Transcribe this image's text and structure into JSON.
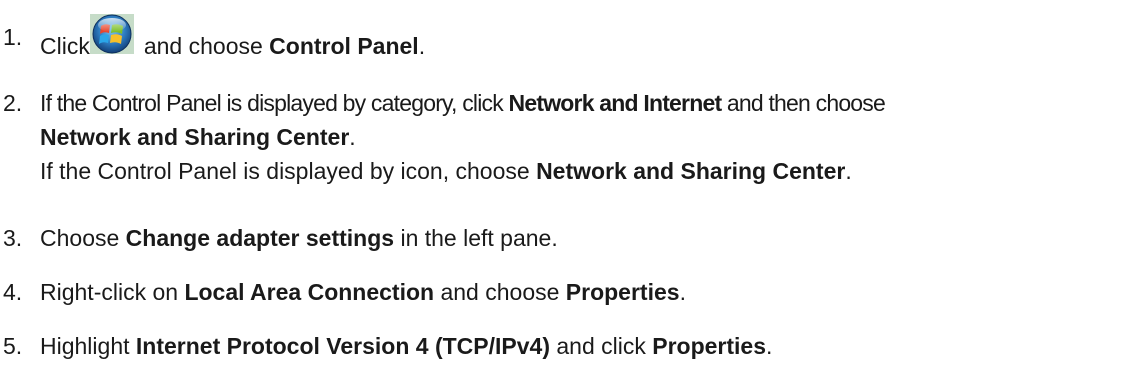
{
  "steps": [
    {
      "number": "1.",
      "click": "Click",
      "icon": "windows-start-orb-icon",
      "after_icon": "and choose",
      "target": "Control Panel",
      "end": "."
    },
    {
      "number": "2.",
      "line1_a": "If the Control Panel is displayed by category, click",
      "line1_b": "Network and Internet",
      "line1_c": "and then choose",
      "line2_a": "Network and Sharing Center",
      "line2_b": ".",
      "line3_a": "If the Control Panel is displayed by icon, choose",
      "line3_b": "Network and Sharing Center",
      "line3_c": "."
    },
    {
      "number": "3.",
      "a": "Choose",
      "b": "Change adapter settings",
      "c": "in the left pane."
    },
    {
      "number": "4.",
      "a": "Right-click on",
      "b": "Local Area Connection",
      "c": "and choose",
      "d": "Properties",
      "e": "."
    },
    {
      "number": "5.",
      "a": "Highlight",
      "b": "Internet Protocol Version 4 (TCP/IPv4)",
      "c": "and click",
      "d": "Properties",
      "e": "."
    }
  ],
  "colors": {
    "text": "#1a1a1a",
    "orb_blue": "#2f6fb8",
    "orb_red": "#e8452c",
    "orb_green": "#7cbf2a",
    "orb_yellow": "#f6c02a",
    "orb_sky": "#2aa6e8"
  }
}
